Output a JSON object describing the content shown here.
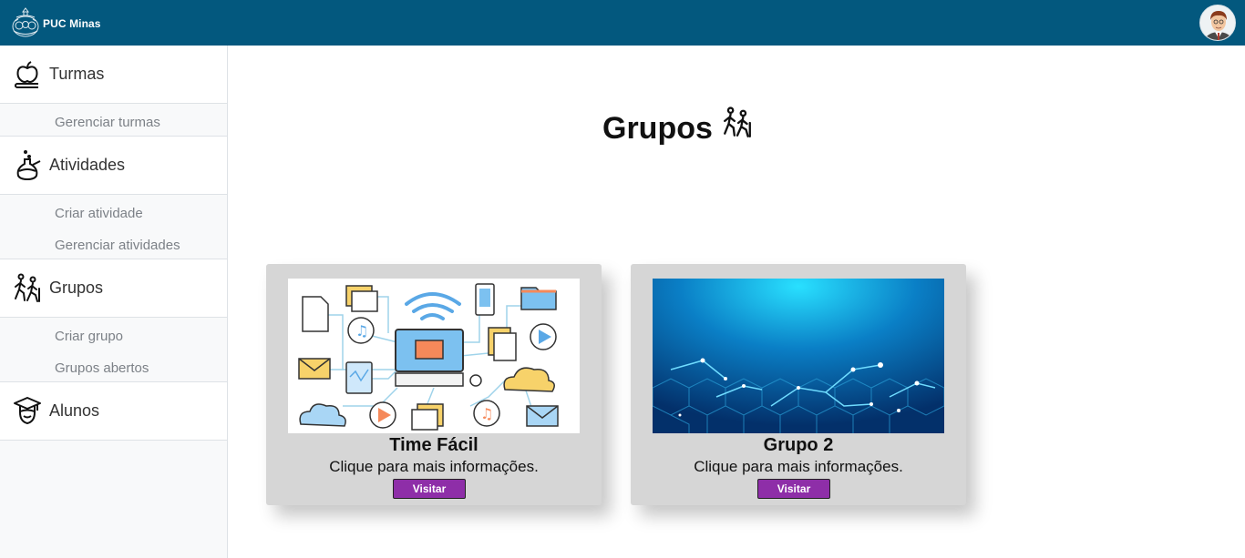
{
  "header": {
    "brand": "PUC Minas",
    "logo_icon": "puc-seal-icon",
    "avatar_icon": "user-avatar-icon",
    "bar_color": "#03587e"
  },
  "sidebar": {
    "sections": [
      {
        "label": "Turmas",
        "icon": "apple-book-icon",
        "items": [
          "Gerenciar turmas"
        ]
      },
      {
        "label": "Atividades",
        "icon": "flask-icon",
        "items": [
          "Criar atividade",
          "Gerenciar atividades"
        ]
      },
      {
        "label": "Grupos",
        "icon": "hikers-icon",
        "items": [
          "Criar grupo",
          "Grupos abertos"
        ]
      },
      {
        "label": "Alunos",
        "icon": "graduate-icon",
        "items": []
      }
    ]
  },
  "main": {
    "title": "Grupos",
    "title_icon": "hikers-icon",
    "cards": [
      {
        "name": "Time Fácil",
        "description": "Clique para mais informações.",
        "button": "Visitar",
        "image": "network-devices-illustration"
      },
      {
        "name": "Grupo 2",
        "description": "Clique para mais informações.",
        "button": "Visitar",
        "image": "blue-tech-circuit-image"
      }
    ],
    "button_color": "#8e2ea8"
  }
}
